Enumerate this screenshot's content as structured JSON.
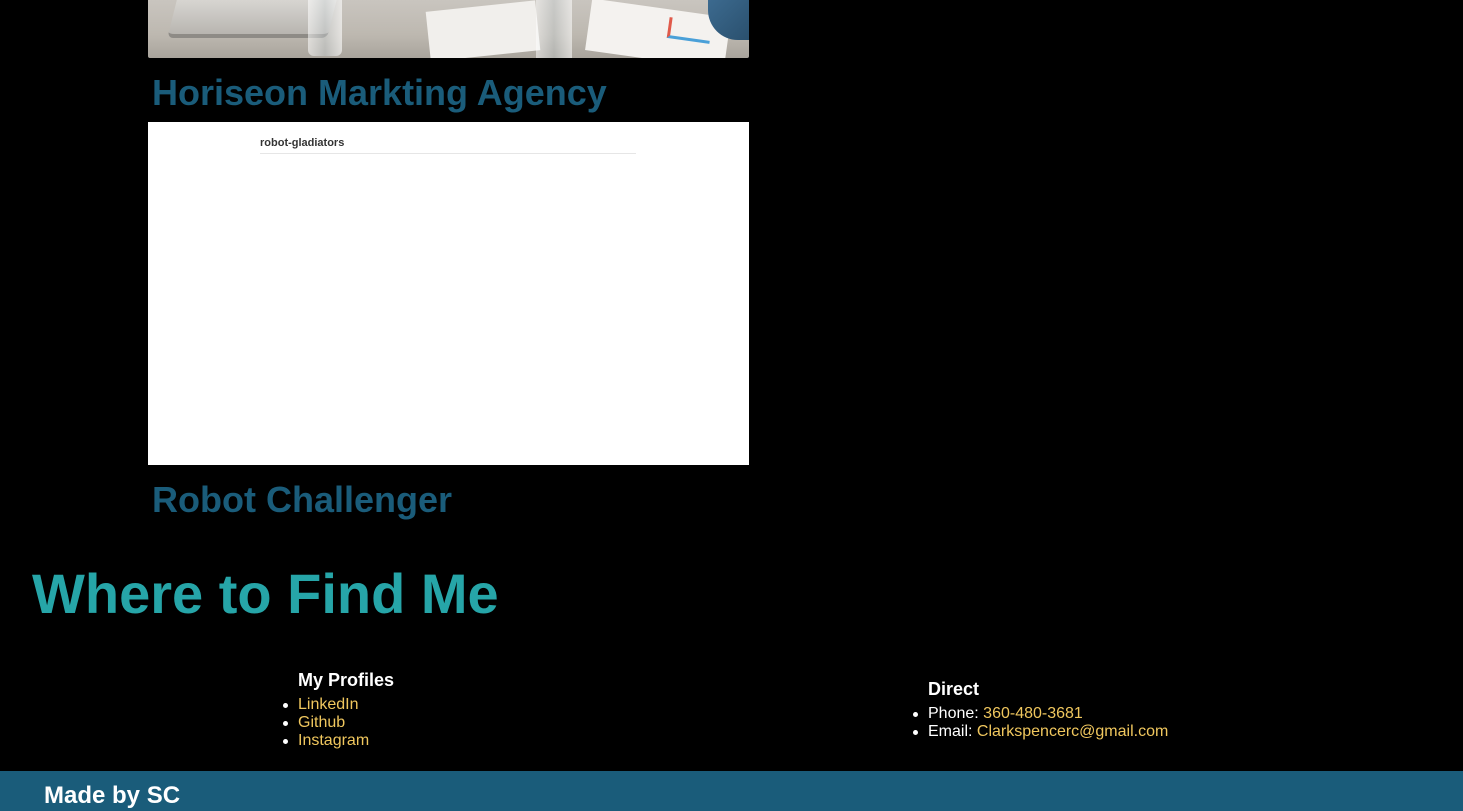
{
  "projects": [
    {
      "title": "Horiseon Markting Agency"
    },
    {
      "title": "Robot Challenger",
      "screenshot_heading": "robot-gladiators"
    }
  ],
  "contact": {
    "heading": "Where to Find Me",
    "profiles": {
      "heading": "My Profiles",
      "links": [
        "LinkedIn",
        "Github",
        "Instagram"
      ]
    },
    "direct": {
      "heading": "Direct",
      "phone_label": "Phone:",
      "phone_value": "360-480-3681",
      "email_label": "Email:",
      "email_value": "Clarkspencerc@gmail.com"
    }
  },
  "footer": {
    "text": "Made by SC"
  },
  "colors": {
    "project_title": "#1a5c7a",
    "section_title": "#26a5a8",
    "link": "#f0c75e",
    "footer_bg": "#1a5c7a",
    "background": "#000000"
  }
}
